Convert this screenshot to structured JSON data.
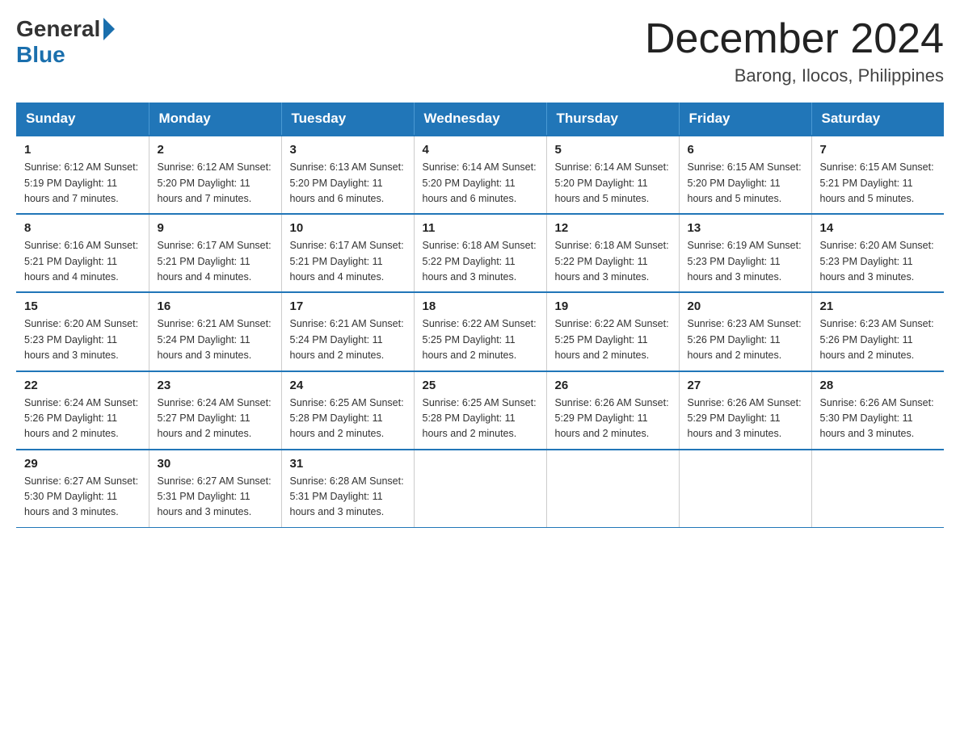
{
  "header": {
    "logo_general": "General",
    "logo_blue": "Blue",
    "month_title": "December 2024",
    "location": "Barong, Ilocos, Philippines"
  },
  "days_of_week": [
    "Sunday",
    "Monday",
    "Tuesday",
    "Wednesday",
    "Thursday",
    "Friday",
    "Saturday"
  ],
  "weeks": [
    [
      {
        "day": "1",
        "info": "Sunrise: 6:12 AM\nSunset: 5:19 PM\nDaylight: 11 hours and 7 minutes."
      },
      {
        "day": "2",
        "info": "Sunrise: 6:12 AM\nSunset: 5:20 PM\nDaylight: 11 hours and 7 minutes."
      },
      {
        "day": "3",
        "info": "Sunrise: 6:13 AM\nSunset: 5:20 PM\nDaylight: 11 hours and 6 minutes."
      },
      {
        "day": "4",
        "info": "Sunrise: 6:14 AM\nSunset: 5:20 PM\nDaylight: 11 hours and 6 minutes."
      },
      {
        "day": "5",
        "info": "Sunrise: 6:14 AM\nSunset: 5:20 PM\nDaylight: 11 hours and 5 minutes."
      },
      {
        "day": "6",
        "info": "Sunrise: 6:15 AM\nSunset: 5:20 PM\nDaylight: 11 hours and 5 minutes."
      },
      {
        "day": "7",
        "info": "Sunrise: 6:15 AM\nSunset: 5:21 PM\nDaylight: 11 hours and 5 minutes."
      }
    ],
    [
      {
        "day": "8",
        "info": "Sunrise: 6:16 AM\nSunset: 5:21 PM\nDaylight: 11 hours and 4 minutes."
      },
      {
        "day": "9",
        "info": "Sunrise: 6:17 AM\nSunset: 5:21 PM\nDaylight: 11 hours and 4 minutes."
      },
      {
        "day": "10",
        "info": "Sunrise: 6:17 AM\nSunset: 5:21 PM\nDaylight: 11 hours and 4 minutes."
      },
      {
        "day": "11",
        "info": "Sunrise: 6:18 AM\nSunset: 5:22 PM\nDaylight: 11 hours and 3 minutes."
      },
      {
        "day": "12",
        "info": "Sunrise: 6:18 AM\nSunset: 5:22 PM\nDaylight: 11 hours and 3 minutes."
      },
      {
        "day": "13",
        "info": "Sunrise: 6:19 AM\nSunset: 5:23 PM\nDaylight: 11 hours and 3 minutes."
      },
      {
        "day": "14",
        "info": "Sunrise: 6:20 AM\nSunset: 5:23 PM\nDaylight: 11 hours and 3 minutes."
      }
    ],
    [
      {
        "day": "15",
        "info": "Sunrise: 6:20 AM\nSunset: 5:23 PM\nDaylight: 11 hours and 3 minutes."
      },
      {
        "day": "16",
        "info": "Sunrise: 6:21 AM\nSunset: 5:24 PM\nDaylight: 11 hours and 3 minutes."
      },
      {
        "day": "17",
        "info": "Sunrise: 6:21 AM\nSunset: 5:24 PM\nDaylight: 11 hours and 2 minutes."
      },
      {
        "day": "18",
        "info": "Sunrise: 6:22 AM\nSunset: 5:25 PM\nDaylight: 11 hours and 2 minutes."
      },
      {
        "day": "19",
        "info": "Sunrise: 6:22 AM\nSunset: 5:25 PM\nDaylight: 11 hours and 2 minutes."
      },
      {
        "day": "20",
        "info": "Sunrise: 6:23 AM\nSunset: 5:26 PM\nDaylight: 11 hours and 2 minutes."
      },
      {
        "day": "21",
        "info": "Sunrise: 6:23 AM\nSunset: 5:26 PM\nDaylight: 11 hours and 2 minutes."
      }
    ],
    [
      {
        "day": "22",
        "info": "Sunrise: 6:24 AM\nSunset: 5:26 PM\nDaylight: 11 hours and 2 minutes."
      },
      {
        "day": "23",
        "info": "Sunrise: 6:24 AM\nSunset: 5:27 PM\nDaylight: 11 hours and 2 minutes."
      },
      {
        "day": "24",
        "info": "Sunrise: 6:25 AM\nSunset: 5:28 PM\nDaylight: 11 hours and 2 minutes."
      },
      {
        "day": "25",
        "info": "Sunrise: 6:25 AM\nSunset: 5:28 PM\nDaylight: 11 hours and 2 minutes."
      },
      {
        "day": "26",
        "info": "Sunrise: 6:26 AM\nSunset: 5:29 PM\nDaylight: 11 hours and 2 minutes."
      },
      {
        "day": "27",
        "info": "Sunrise: 6:26 AM\nSunset: 5:29 PM\nDaylight: 11 hours and 3 minutes."
      },
      {
        "day": "28",
        "info": "Sunrise: 6:26 AM\nSunset: 5:30 PM\nDaylight: 11 hours and 3 minutes."
      }
    ],
    [
      {
        "day": "29",
        "info": "Sunrise: 6:27 AM\nSunset: 5:30 PM\nDaylight: 11 hours and 3 minutes."
      },
      {
        "day": "30",
        "info": "Sunrise: 6:27 AM\nSunset: 5:31 PM\nDaylight: 11 hours and 3 minutes."
      },
      {
        "day": "31",
        "info": "Sunrise: 6:28 AM\nSunset: 5:31 PM\nDaylight: 11 hours and 3 minutes."
      },
      null,
      null,
      null,
      null
    ]
  ]
}
